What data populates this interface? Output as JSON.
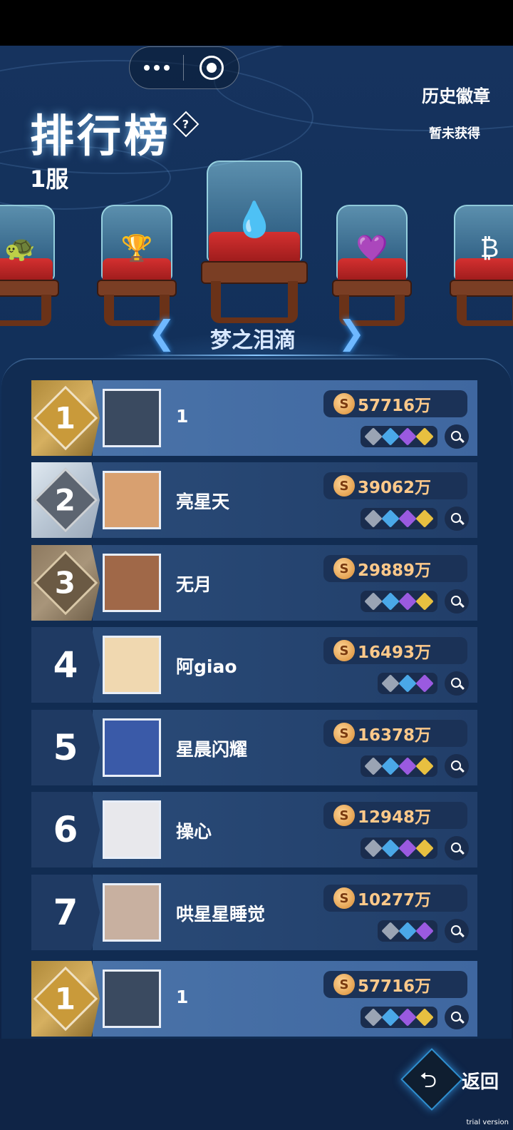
{
  "window": {
    "menu_dots_icon": "more-dots-icon",
    "close_icon": "target-circle-icon"
  },
  "header": {
    "title": "排行榜",
    "help_symbol": "?",
    "server": "1服",
    "history_title": "历史徽章",
    "history_status": "暂未获得"
  },
  "carousel": {
    "selected_name": "梦之泪滴",
    "prev_symbol": "❮",
    "next_symbol": "❯",
    "items": [
      {
        "icon": "turtle-icon",
        "glyph": "🐢"
      },
      {
        "icon": "golden-trophy-icon",
        "glyph": "🏆"
      },
      {
        "icon": "dream-teardrop-icon",
        "glyph": "💧"
      },
      {
        "icon": "heart-gem-icon",
        "glyph": "💜"
      },
      {
        "icon": "bitcoin-icon",
        "glyph": "₿"
      }
    ]
  },
  "coin_symbol": "S",
  "rankings": [
    {
      "rank": "1",
      "name": "1",
      "score": "57716万",
      "avatar_icon": "avatar-ninja-cat",
      "avatar_bg": "#3a4a60",
      "badges": [
        "#9aa4b4",
        "#4aa8e8",
        "#9a5ae0",
        "#e8c040"
      ]
    },
    {
      "rank": "2",
      "name": "亮星天",
      "score": "39062万",
      "avatar_icon": "avatar-cartoon-boy",
      "avatar_bg": "#d8a070",
      "badges": [
        "#9aa4b4",
        "#4aa8e8",
        "#9a5ae0",
        "#e8c040"
      ]
    },
    {
      "rank": "3",
      "name": "无月",
      "score": "29889万",
      "avatar_icon": "avatar-goddess",
      "avatar_bg": "#a06848",
      "badges": [
        "#9aa4b4",
        "#4aa8e8",
        "#9a5ae0",
        "#e8c040"
      ]
    },
    {
      "rank": "4",
      "name": "阿giao",
      "score": "16493万",
      "avatar_icon": "avatar-shiba",
      "avatar_bg": "#f0d8b0",
      "badges": [
        "#9aa4b4",
        "#4aa8e8",
        "#9a5ae0"
      ]
    },
    {
      "rank": "5",
      "name": "星晨闪耀",
      "score": "16378万",
      "avatar_icon": "avatar-astronaut-dog",
      "avatar_bg": "#3a5aa8",
      "badges": [
        "#9aa4b4",
        "#4aa8e8",
        "#9a5ae0",
        "#e8c040"
      ]
    },
    {
      "rank": "6",
      "name": "操心",
      "score": "12948万",
      "avatar_icon": "avatar-anime-girl",
      "avatar_bg": "#e8e8ec",
      "badges": [
        "#9aa4b4",
        "#4aa8e8",
        "#9a5ae0",
        "#e8c040"
      ]
    },
    {
      "rank": "7",
      "name": "哄星星睡觉",
      "score": "10277万",
      "avatar_icon": "avatar-photo",
      "avatar_bg": "#c8b0a0",
      "badges": [
        "#9aa4b4",
        "#4aa8e8",
        "#9a5ae0"
      ]
    }
  ],
  "my_rank": {
    "rank": "1",
    "name": "1",
    "score": "57716万",
    "avatar_icon": "avatar-ninja-cat",
    "avatar_bg": "#3a4a60",
    "badges": [
      "#9aa4b4",
      "#4aa8e8",
      "#9a5ae0",
      "#e8c040"
    ]
  },
  "footer": {
    "back_label": "返回",
    "back_symbol": "⮌",
    "watermark": "trial version"
  }
}
